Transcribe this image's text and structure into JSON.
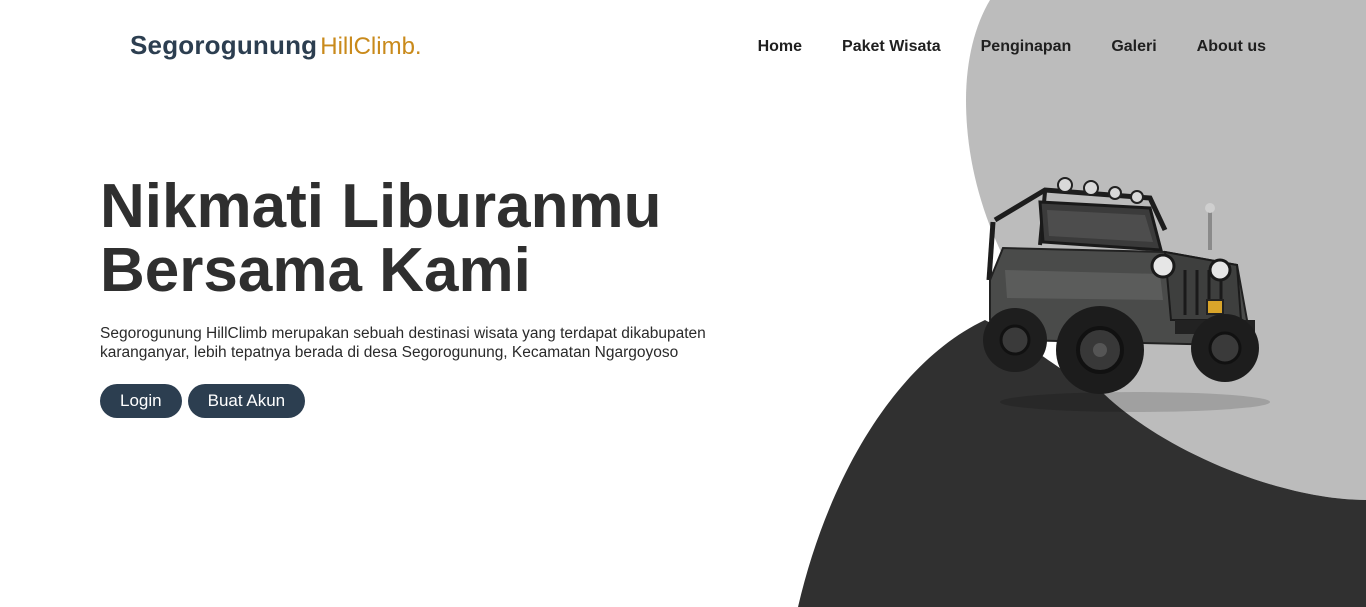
{
  "brand": {
    "name_main": "Segorogunung",
    "name_accent": "HillClimb.",
    "main_color": "#2c3e50",
    "accent_color": "#c98a1b"
  },
  "nav": {
    "items": [
      {
        "label": "Home"
      },
      {
        "label": "Paket Wisata"
      },
      {
        "label": "Penginapan"
      },
      {
        "label": "Galeri"
      },
      {
        "label": "About us"
      }
    ]
  },
  "hero": {
    "title_line1": "Nikmati Liburanmu",
    "title_line2": "Bersama Kami",
    "description": "Segorogunung HillClimb merupakan sebuah destinasi wisata yang terdapat dikabupaten karanganyar, lebih tepatnya berada di desa Segorogunung, Kecamatan Ngargoyoso",
    "login_label": "Login",
    "signup_label": "Buat Akun"
  },
  "illustration": {
    "icon": "jeep-icon",
    "light_shape_color": "#bcbcbc",
    "dark_shape_color": "#303030"
  }
}
